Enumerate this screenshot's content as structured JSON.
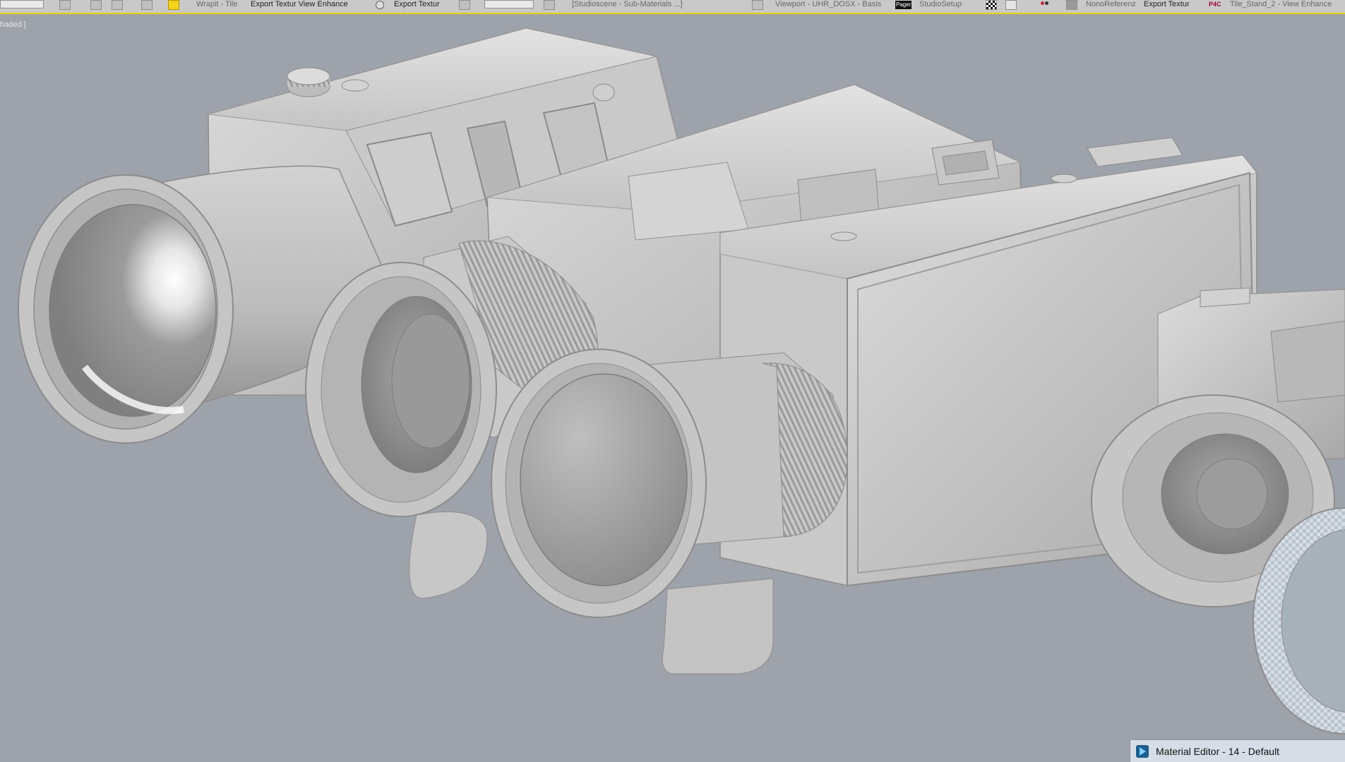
{
  "toolbar": {
    "item_wrapit": "Wrapit - Tile",
    "item_export_view": "Export Textur View Enhance",
    "item_export_textur": "Export Textur",
    "item_studioscene": "[Studioscene - Sub-Materials ...]",
    "item_viewport": "Viewport - UHR_DOSX - Basis",
    "item_pager": "Pager",
    "item_studiosetup": "StudioSetup",
    "item_nonoreferenz": "NonoReferenz",
    "item_export_textur2": "Export Textur",
    "item_p4c": "P4C",
    "item_tile": "Tile_Stand_2 - View Enhance"
  },
  "viewport": {
    "label": "haded ]"
  },
  "taskbar": {
    "material_editor_label": "Material Editor - 14 - Default"
  },
  "colors": {
    "background": "#9ea2aa",
    "toolbar_accent": "#e8d400",
    "model_light": "#d9d9d9",
    "model_mid": "#bdbdbd",
    "model_dark": "#8f8f8f"
  }
}
